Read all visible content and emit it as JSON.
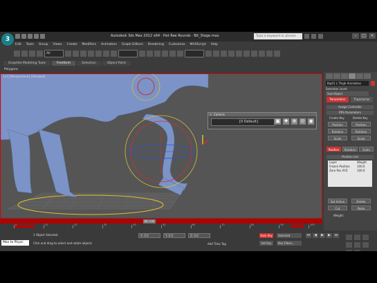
{
  "window": {
    "title": "Autodesk 3ds Max 2012 x64 · Hot Ree Rounds · Bit_Stage.max",
    "search_placeholder": "Type a keyword or phrase"
  },
  "menu": [
    "Edit",
    "Tools",
    "Group",
    "Views",
    "Create",
    "Modifiers",
    "Animation",
    "Graph Editors",
    "Rendering",
    "Customize",
    "MAXScript",
    "Help"
  ],
  "toolbar": {
    "selection_filter": "All"
  },
  "ribbon_tabs": [
    "Graphite Modeling Tools",
    "Freeform",
    "Selection",
    "Object Paint"
  ],
  "ribbon_active": 1,
  "panel_label": "Polygons",
  "viewport": {
    "label": "[+] [Perspective] [Shaded]"
  },
  "float_toolbar": {
    "title": "Camera",
    "value": "[0 Default]"
  },
  "command_panel": {
    "object_name": "Bip01 L Thigh Animation",
    "selection_level_label": "Selection Level:",
    "selection_level_value": "Sub-Object",
    "mode_buttons": [
      "Parameters",
      "Trajectories"
    ],
    "assign_controller": "Assign Controller",
    "ik_parameters": "PRS Parameters",
    "create_key": "Create Key",
    "delete_key": "Delete Key",
    "keys": [
      "Position",
      "Position",
      "Rotation",
      "Rotation",
      "Scale",
      "Scale"
    ],
    "tabs": [
      "Position",
      "Rotation",
      "Scale"
    ],
    "position_list": "Position List",
    "layer_header": [
      "Layer",
      "Weight"
    ],
    "layers": [
      {
        "name": "Frozen Position",
        "weight": "100.0"
      },
      {
        "name": "Zero Pos XYZ",
        "weight": "100.0"
      }
    ],
    "set_active": "Set Active",
    "delete": "Delete",
    "cut": "Cut",
    "paste": "Paste",
    "weight_label": "Weight:"
  },
  "timeline": {
    "current_frame": "80 / 100",
    "ticks": [
      "0",
      "10",
      "20",
      "30",
      "40",
      "50",
      "60",
      "70",
      "80",
      "90",
      "100"
    ]
  },
  "status": {
    "maxscript": "Max to Physc",
    "selection": "1 Object Selected",
    "prompt": "Click and drag to select and rotate objects",
    "x": "X: 0.0",
    "y": "Y: 0.0",
    "z": "Z: 0.0",
    "add_time_tag": "Add Time Tag",
    "auto_key": "Auto Key",
    "set_key": "Set Key",
    "selected": "Selected",
    "key_filters": "Key Filters..."
  }
}
